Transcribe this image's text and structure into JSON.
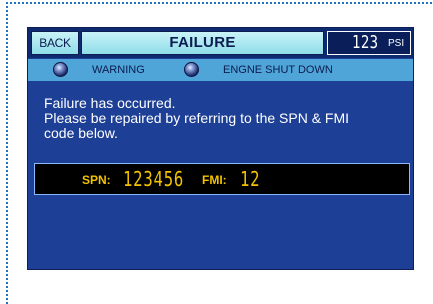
{
  "header": {
    "back_label": "BACK",
    "title": "FAILURE",
    "pressure_value": "123",
    "pressure_unit": "PSI"
  },
  "status": [
    {
      "label": "WARNING",
      "icon": "warning-indicator-led"
    },
    {
      "label": "ENGNE SHUT DOWN",
      "icon": "engine-shutdown-indicator-led"
    }
  ],
  "message": {
    "line1": "Failure has occurred.",
    "line2": "Please be repaired by referring to the SPN & FMI",
    "line3": "code below."
  },
  "codes": {
    "spn_label": "SPN:",
    "spn_value": "123456",
    "fmi_label": "FMI:",
    "fmi_value": "12"
  },
  "colors": {
    "screen_bg": "#1d3f96",
    "header_button": "#b6ecf4",
    "status_row": "#4fa4d8",
    "code_text": "#f2c200",
    "frame_dots": "#1f74c8"
  }
}
